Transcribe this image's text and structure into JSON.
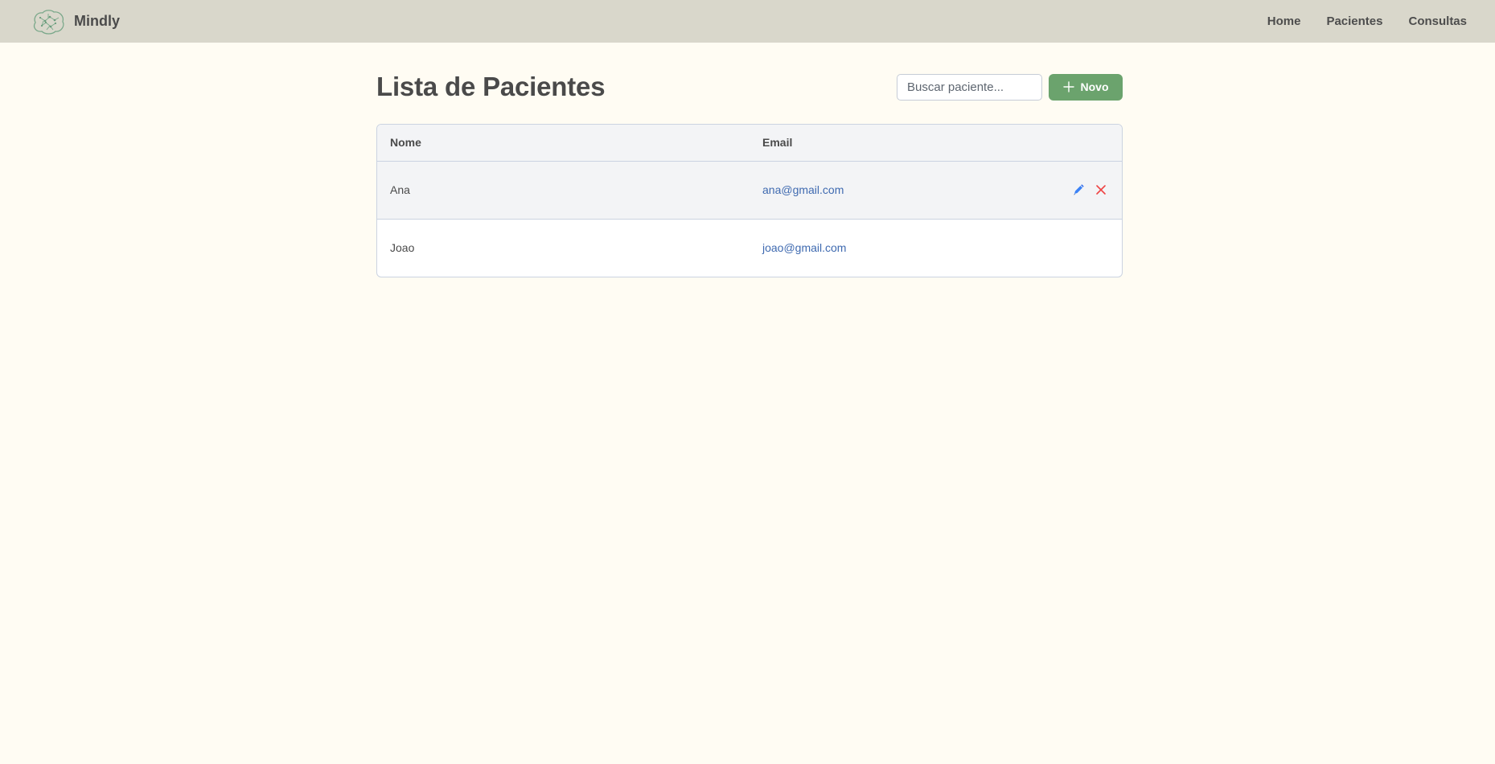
{
  "navbar": {
    "brand_name": "Mindly",
    "links": [
      {
        "label": "Home"
      },
      {
        "label": "Pacientes"
      },
      {
        "label": "Consultas"
      }
    ]
  },
  "page": {
    "title": "Lista de Pacientes"
  },
  "search": {
    "placeholder": "Buscar paciente...",
    "value": ""
  },
  "new_button": {
    "label": "Novo",
    "icon": "plus-icon",
    "color": "#6ba36d"
  },
  "table": {
    "columns": [
      "Nome",
      "Email"
    ],
    "rows": [
      {
        "name": "Ana",
        "email": "ana@gmail.com",
        "actions": [
          "edit-pencil-icon",
          "delete-x-icon"
        ]
      },
      {
        "name": "Joao",
        "email": "joao@gmail.com",
        "actions": []
      }
    ]
  },
  "colors": {
    "navbar_bg": "#d9d7cb",
    "page_bg": "#fffcf3",
    "email_link": "#3f6ab0",
    "edit_icon": "#3b82f6",
    "delete_icon": "#ef4444"
  }
}
